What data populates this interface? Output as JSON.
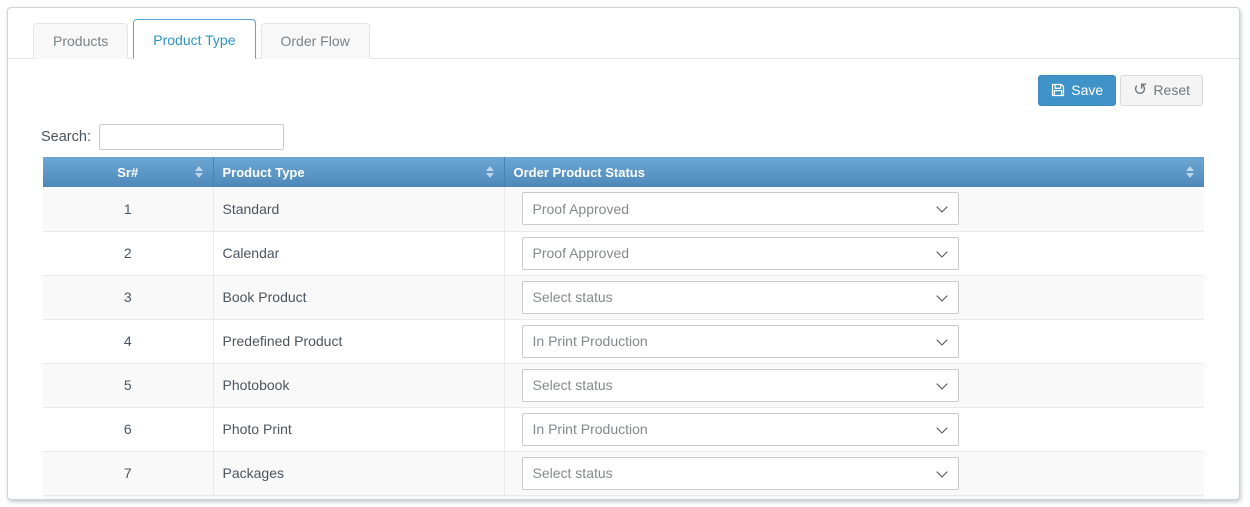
{
  "tabs": [
    {
      "label": "Products",
      "active": false
    },
    {
      "label": "Product Type",
      "active": true
    },
    {
      "label": "Order Flow",
      "active": false
    }
  ],
  "toolbar": {
    "save_label": "Save",
    "reset_label": "Reset"
  },
  "search": {
    "label": "Search:",
    "value": ""
  },
  "table": {
    "columns": [
      {
        "label": "Sr#",
        "sortable": true
      },
      {
        "label": "Product Type",
        "sortable": true
      },
      {
        "label": "Order Product Status",
        "sortable": true
      }
    ],
    "rows": [
      {
        "sr": "1",
        "product_type": "Standard",
        "status": "Proof Approved"
      },
      {
        "sr": "2",
        "product_type": "Calendar",
        "status": "Proof Approved"
      },
      {
        "sr": "3",
        "product_type": "Book Product",
        "status": "Select status"
      },
      {
        "sr": "4",
        "product_type": "Predefined Product",
        "status": "In Print Production"
      },
      {
        "sr": "5",
        "product_type": "Photobook",
        "status": "Select status"
      },
      {
        "sr": "6",
        "product_type": "Photo Print",
        "status": "In Print Production"
      },
      {
        "sr": "7",
        "product_type": "Packages",
        "status": "Select status"
      }
    ]
  },
  "icons": {
    "save": "floppy-disk-icon",
    "reset": "undo-arrow-icon",
    "sort": "sort-arrows-icon",
    "select": "chevron-down-icon"
  },
  "colors": {
    "active_tab_border": "#58a4d8",
    "active_tab_text": "#2c94c9",
    "table_header_top": "#6ca7d5",
    "table_header_bottom": "#4d88b9",
    "save_button_bg": "#4093c9",
    "reset_button_bg": "#f4f4f4",
    "row_stripe": "#f9f9f9"
  }
}
